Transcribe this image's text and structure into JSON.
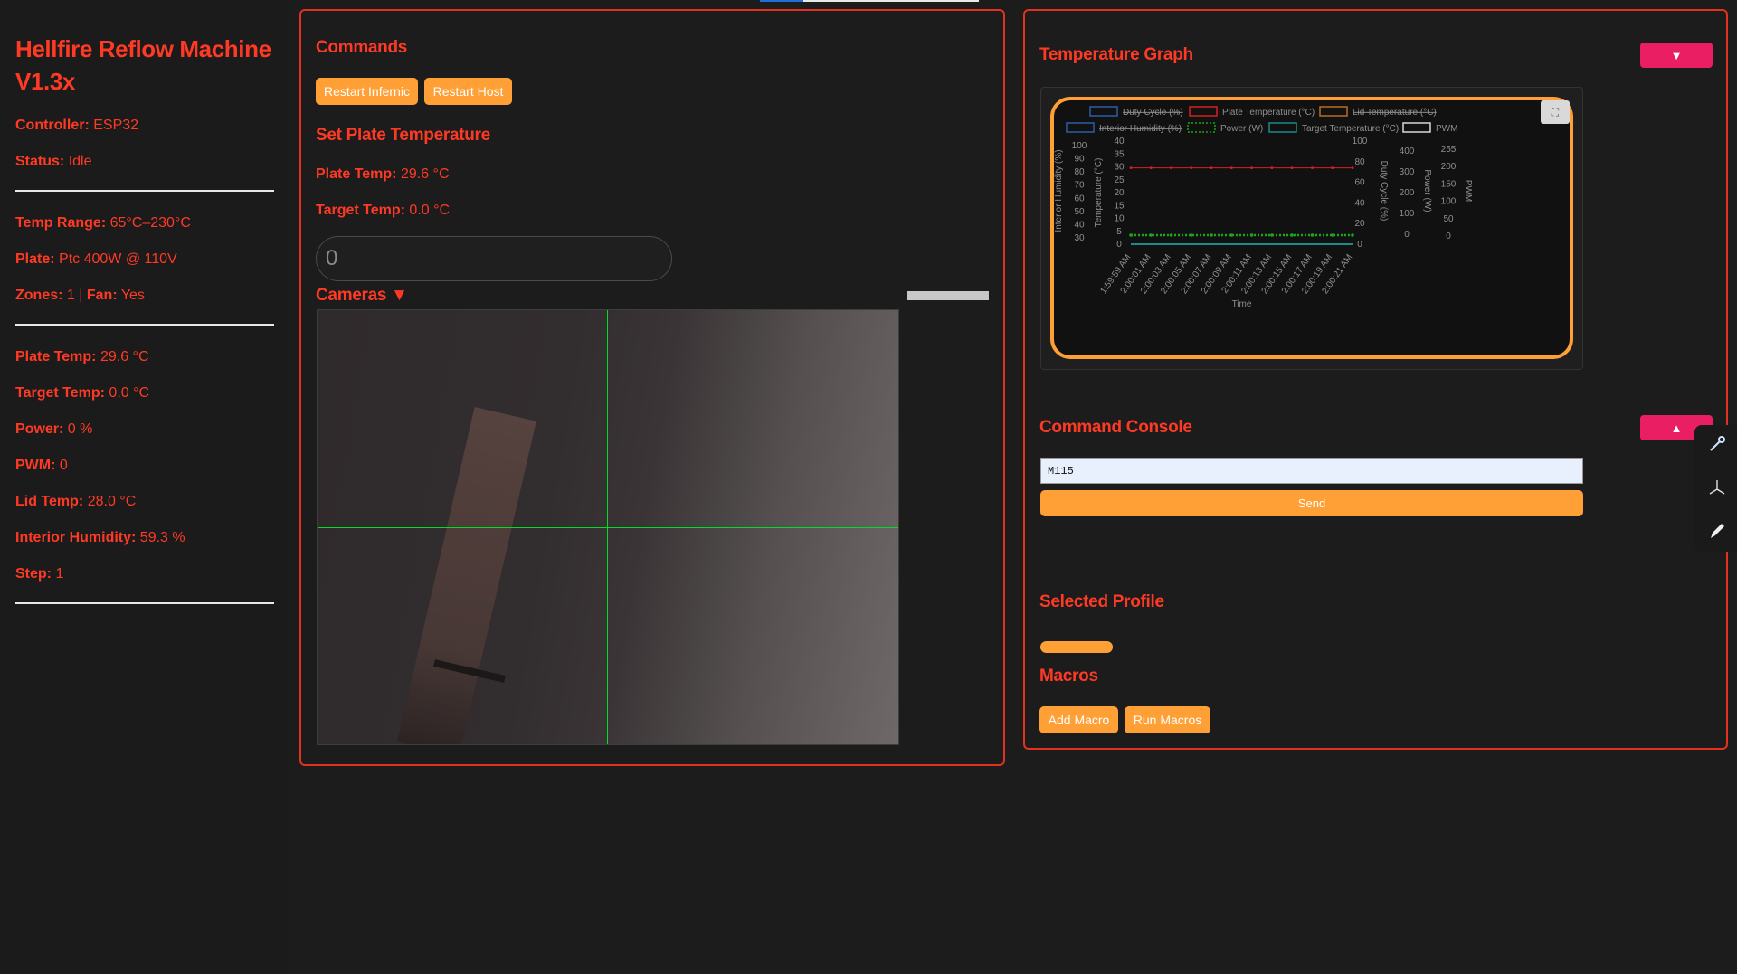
{
  "sidebar": {
    "title": "Hellfire Reflow Machine V1.3x",
    "status_group": [
      {
        "label": "Controller:",
        "value": "ESP32"
      },
      {
        "label": "Status:",
        "value": "Idle"
      }
    ],
    "spec_group": [
      {
        "label": "Temp Range:",
        "value": "65°C–230°C"
      },
      {
        "label": "Plate:",
        "value": "Ptc 400W @ 110V"
      }
    ],
    "zones": {
      "label": "Zones:",
      "value": "1",
      "sep": "|",
      "fan_label": "Fan:",
      "fan_value": "Yes"
    },
    "readings": [
      {
        "label": "Plate Temp:",
        "value": "29.6 °C"
      },
      {
        "label": "Target Temp:",
        "value": "0.0 °C"
      },
      {
        "label": "Power:",
        "value": "0 %"
      },
      {
        "label": "PWM:",
        "value": "0"
      },
      {
        "label": "Lid Temp:",
        "value": "28.0 °C"
      },
      {
        "label": "Interior Humidity:",
        "value": "59.3 %"
      },
      {
        "label": "Step:",
        "value": "1"
      }
    ]
  },
  "commands": {
    "heading": "Commands",
    "restart_infernic": "Restart Infernic",
    "restart_host": "Restart Host",
    "set_plate_heading": "Set Plate Temperature",
    "plate_temp_label": "Plate Temp:",
    "plate_temp_value": "29.6 °C",
    "target_temp_label": "Target Temp:",
    "target_temp_value": "0.0 °C",
    "temp_input_value": "0",
    "cameras_label": "Cameras",
    "cameras_caret": "▼"
  },
  "graph": {
    "heading": "Temperature Graph",
    "toggle_icon": "▼",
    "expand_icon": "⛶"
  },
  "chart_data": {
    "type": "line",
    "xlabel": "Time",
    "x": [
      "1:59:59 AM",
      "2:00:01 AM",
      "2:00:03 AM",
      "2:00:05 AM",
      "2:00:07 AM",
      "2:00:09 AM",
      "2:00:11 AM",
      "2:00:13 AM",
      "2:00:15 AM",
      "2:00:17 AM",
      "2:00:19 AM",
      "2:00:21 AM"
    ],
    "legend": [
      {
        "name": "Duty Cycle (%)",
        "color": "#2b5ea7",
        "hidden": true
      },
      {
        "name": "Plate Temperature (°C)",
        "color": "#d62020",
        "hidden": false
      },
      {
        "name": "Lid Temperature (°C)",
        "color": "#b86e1e",
        "hidden": true
      },
      {
        "name": "Interior Humidity (%)",
        "color": "#2b5ea7",
        "hidden": true
      },
      {
        "name": "Power (W)",
        "color": "#19a619",
        "hidden": false,
        "dotted": true
      },
      {
        "name": "Target Temperature (°C)",
        "color": "#1a8a8a",
        "hidden": false
      },
      {
        "name": "PWM",
        "color": "#d8d8d8",
        "hidden": false
      }
    ],
    "axes": {
      "humidity": {
        "label": "Interior Humidity (%)",
        "ticks": [
          "100",
          "90",
          "80",
          "70",
          "60",
          "50",
          "40",
          "30"
        ],
        "range": [
          30,
          100
        ]
      },
      "temperature": {
        "label": "Temperature (°C)",
        "ticks": [
          "40",
          "35",
          "30",
          "25",
          "20",
          "15",
          "10",
          "5",
          "0"
        ],
        "range": [
          0,
          40
        ]
      },
      "duty": {
        "label": "Duty Cycle (%)",
        "ticks": [
          "100",
          "80",
          "60",
          "40",
          "20",
          "0"
        ],
        "range": [
          0,
          100
        ]
      },
      "power": {
        "label": "Power (W)",
        "ticks": [
          "400",
          "300",
          "200",
          "100",
          "0"
        ],
        "range": [
          0,
          400
        ]
      },
      "pwm": {
        "label": "PWM",
        "ticks": [
          "255",
          "200",
          "150",
          "100",
          "50",
          "0"
        ],
        "range": [
          0,
          255
        ]
      }
    },
    "series": [
      {
        "name": "Plate Temperature (°C)",
        "axis": "temperature",
        "values": [
          29.6,
          29.6,
          29.6,
          29.6,
          29.6,
          29.6,
          29.6,
          29.6,
          29.6,
          29.6,
          29.6,
          29.6
        ]
      },
      {
        "name": "Power (W)",
        "axis": "power",
        "values": [
          0,
          0,
          0,
          0,
          0,
          0,
          0,
          0,
          0,
          0,
          0,
          0
        ]
      },
      {
        "name": "Target Temperature (°C)",
        "axis": "temperature",
        "values": [
          0,
          0,
          0,
          0,
          0,
          0,
          0,
          0,
          0,
          0,
          0,
          0
        ]
      }
    ]
  },
  "console": {
    "heading": "Command Console",
    "toggle_icon": "▲",
    "input_value": "M115",
    "send_label": "Send"
  },
  "profile": {
    "heading": "Selected Profile"
  },
  "macros": {
    "heading": "Macros",
    "add_label": "Add Macro",
    "run_label": "Run Macros"
  }
}
